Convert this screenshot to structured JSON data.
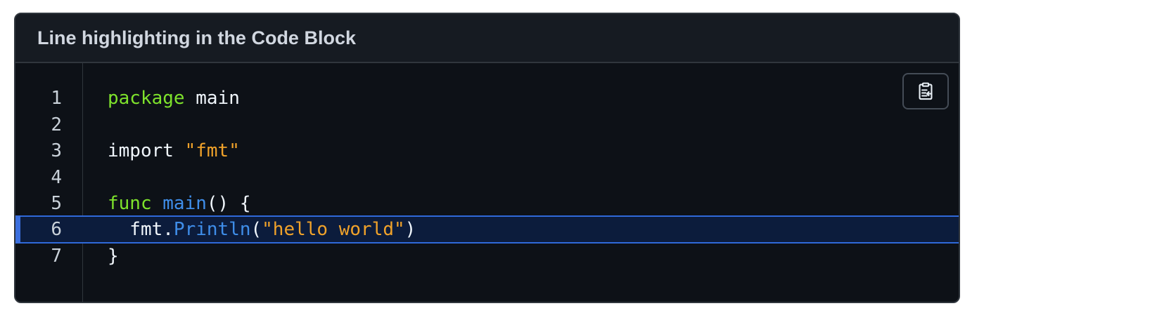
{
  "card": {
    "title": "Line highlighting in the Code Block"
  },
  "copy_button": {
    "icon": "clipboard-copy-icon"
  },
  "highlighted_line": 6,
  "lines": [
    {
      "number": "1",
      "tokens": [
        {
          "text": "package",
          "kind": "keyword"
        },
        {
          "text": " main",
          "kind": "plain"
        }
      ]
    },
    {
      "number": "2",
      "tokens": []
    },
    {
      "number": "3",
      "tokens": [
        {
          "text": "import ",
          "kind": "plain"
        },
        {
          "text": "\"fmt\"",
          "kind": "string"
        }
      ]
    },
    {
      "number": "4",
      "tokens": []
    },
    {
      "number": "5",
      "tokens": [
        {
          "text": "func",
          "kind": "keyword"
        },
        {
          "text": " ",
          "kind": "plain"
        },
        {
          "text": "main",
          "kind": "func"
        },
        {
          "text": "() {",
          "kind": "plain"
        }
      ]
    },
    {
      "number": "6",
      "tokens": [
        {
          "text": "  fmt.",
          "kind": "plain"
        },
        {
          "text": "Println",
          "kind": "func"
        },
        {
          "text": "(",
          "kind": "plain"
        },
        {
          "text": "\"hello world\"",
          "kind": "string"
        },
        {
          "text": ")",
          "kind": "plain"
        }
      ]
    },
    {
      "number": "7",
      "tokens": [
        {
          "text": "}",
          "kind": "plain"
        }
      ]
    }
  ],
  "colors": {
    "background": "#0d1117",
    "header_background": "#161b22",
    "border": "#30363d",
    "keyword": "#7ee22c",
    "string": "#f0a22a",
    "function": "#3f8eea",
    "plain": "#f0f6fc",
    "highlight_background": "#0c1c3c",
    "highlight_border": "#2f69d9"
  }
}
